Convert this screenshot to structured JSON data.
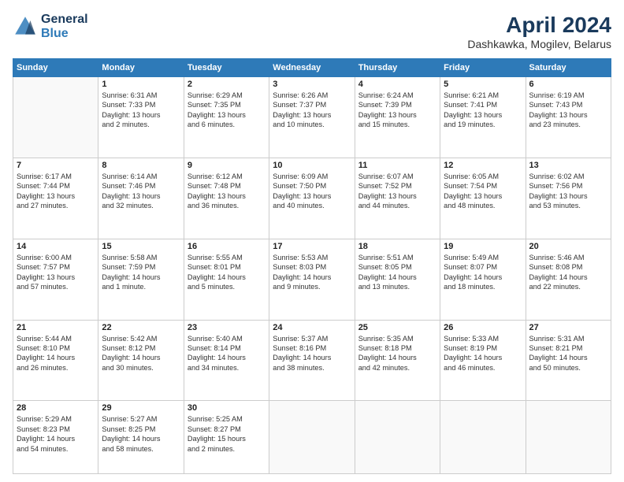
{
  "logo": {
    "line1": "General",
    "line2": "Blue"
  },
  "title": "April 2024",
  "location": "Dashkawka, Mogilev, Belarus",
  "days_of_week": [
    "Sunday",
    "Monday",
    "Tuesday",
    "Wednesday",
    "Thursday",
    "Friday",
    "Saturday"
  ],
  "weeks": [
    [
      {
        "day": "",
        "info": ""
      },
      {
        "day": "1",
        "info": "Sunrise: 6:31 AM\nSunset: 7:33 PM\nDaylight: 13 hours\nand 2 minutes."
      },
      {
        "day": "2",
        "info": "Sunrise: 6:29 AM\nSunset: 7:35 PM\nDaylight: 13 hours\nand 6 minutes."
      },
      {
        "day": "3",
        "info": "Sunrise: 6:26 AM\nSunset: 7:37 PM\nDaylight: 13 hours\nand 10 minutes."
      },
      {
        "day": "4",
        "info": "Sunrise: 6:24 AM\nSunset: 7:39 PM\nDaylight: 13 hours\nand 15 minutes."
      },
      {
        "day": "5",
        "info": "Sunrise: 6:21 AM\nSunset: 7:41 PM\nDaylight: 13 hours\nand 19 minutes."
      },
      {
        "day": "6",
        "info": "Sunrise: 6:19 AM\nSunset: 7:43 PM\nDaylight: 13 hours\nand 23 minutes."
      }
    ],
    [
      {
        "day": "7",
        "info": "Sunrise: 6:17 AM\nSunset: 7:44 PM\nDaylight: 13 hours\nand 27 minutes."
      },
      {
        "day": "8",
        "info": "Sunrise: 6:14 AM\nSunset: 7:46 PM\nDaylight: 13 hours\nand 32 minutes."
      },
      {
        "day": "9",
        "info": "Sunrise: 6:12 AM\nSunset: 7:48 PM\nDaylight: 13 hours\nand 36 minutes."
      },
      {
        "day": "10",
        "info": "Sunrise: 6:09 AM\nSunset: 7:50 PM\nDaylight: 13 hours\nand 40 minutes."
      },
      {
        "day": "11",
        "info": "Sunrise: 6:07 AM\nSunset: 7:52 PM\nDaylight: 13 hours\nand 44 minutes."
      },
      {
        "day": "12",
        "info": "Sunrise: 6:05 AM\nSunset: 7:54 PM\nDaylight: 13 hours\nand 48 minutes."
      },
      {
        "day": "13",
        "info": "Sunrise: 6:02 AM\nSunset: 7:56 PM\nDaylight: 13 hours\nand 53 minutes."
      }
    ],
    [
      {
        "day": "14",
        "info": "Sunrise: 6:00 AM\nSunset: 7:57 PM\nDaylight: 13 hours\nand 57 minutes."
      },
      {
        "day": "15",
        "info": "Sunrise: 5:58 AM\nSunset: 7:59 PM\nDaylight: 14 hours\nand 1 minute."
      },
      {
        "day": "16",
        "info": "Sunrise: 5:55 AM\nSunset: 8:01 PM\nDaylight: 14 hours\nand 5 minutes."
      },
      {
        "day": "17",
        "info": "Sunrise: 5:53 AM\nSunset: 8:03 PM\nDaylight: 14 hours\nand 9 minutes."
      },
      {
        "day": "18",
        "info": "Sunrise: 5:51 AM\nSunset: 8:05 PM\nDaylight: 14 hours\nand 13 minutes."
      },
      {
        "day": "19",
        "info": "Sunrise: 5:49 AM\nSunset: 8:07 PM\nDaylight: 14 hours\nand 18 minutes."
      },
      {
        "day": "20",
        "info": "Sunrise: 5:46 AM\nSunset: 8:08 PM\nDaylight: 14 hours\nand 22 minutes."
      }
    ],
    [
      {
        "day": "21",
        "info": "Sunrise: 5:44 AM\nSunset: 8:10 PM\nDaylight: 14 hours\nand 26 minutes."
      },
      {
        "day": "22",
        "info": "Sunrise: 5:42 AM\nSunset: 8:12 PM\nDaylight: 14 hours\nand 30 minutes."
      },
      {
        "day": "23",
        "info": "Sunrise: 5:40 AM\nSunset: 8:14 PM\nDaylight: 14 hours\nand 34 minutes."
      },
      {
        "day": "24",
        "info": "Sunrise: 5:37 AM\nSunset: 8:16 PM\nDaylight: 14 hours\nand 38 minutes."
      },
      {
        "day": "25",
        "info": "Sunrise: 5:35 AM\nSunset: 8:18 PM\nDaylight: 14 hours\nand 42 minutes."
      },
      {
        "day": "26",
        "info": "Sunrise: 5:33 AM\nSunset: 8:19 PM\nDaylight: 14 hours\nand 46 minutes."
      },
      {
        "day": "27",
        "info": "Sunrise: 5:31 AM\nSunset: 8:21 PM\nDaylight: 14 hours\nand 50 minutes."
      }
    ],
    [
      {
        "day": "28",
        "info": "Sunrise: 5:29 AM\nSunset: 8:23 PM\nDaylight: 14 hours\nand 54 minutes."
      },
      {
        "day": "29",
        "info": "Sunrise: 5:27 AM\nSunset: 8:25 PM\nDaylight: 14 hours\nand 58 minutes."
      },
      {
        "day": "30",
        "info": "Sunrise: 5:25 AM\nSunset: 8:27 PM\nDaylight: 15 hours\nand 2 minutes."
      },
      {
        "day": "",
        "info": ""
      },
      {
        "day": "",
        "info": ""
      },
      {
        "day": "",
        "info": ""
      },
      {
        "day": "",
        "info": ""
      }
    ]
  ]
}
